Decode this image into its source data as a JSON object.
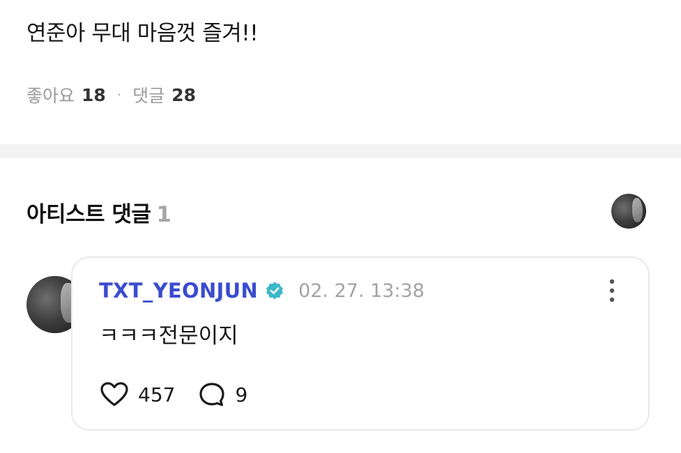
{
  "post": {
    "text": "연준아 무대 마음껏 즐겨!!",
    "likes_label": "좋아요",
    "likes_count": "18",
    "separator": "·",
    "comments_label": "댓글",
    "comments_count": "28"
  },
  "artist_comments": {
    "title": "아티스트 댓글",
    "count": "1"
  },
  "comment": {
    "author": "TXT_YEONJUN",
    "timestamp": "02. 27. 13:38",
    "text": "ㅋㅋㅋ전문이지",
    "likes": "457",
    "replies": "9"
  },
  "colors": {
    "author_name": "#3b4ccf",
    "verified_badge": "#3bb8c9",
    "divider": "#f2f2f2"
  },
  "icons": [
    "verified-badge-icon",
    "more-options-icon",
    "heart-icon",
    "comment-bubble-icon"
  ]
}
